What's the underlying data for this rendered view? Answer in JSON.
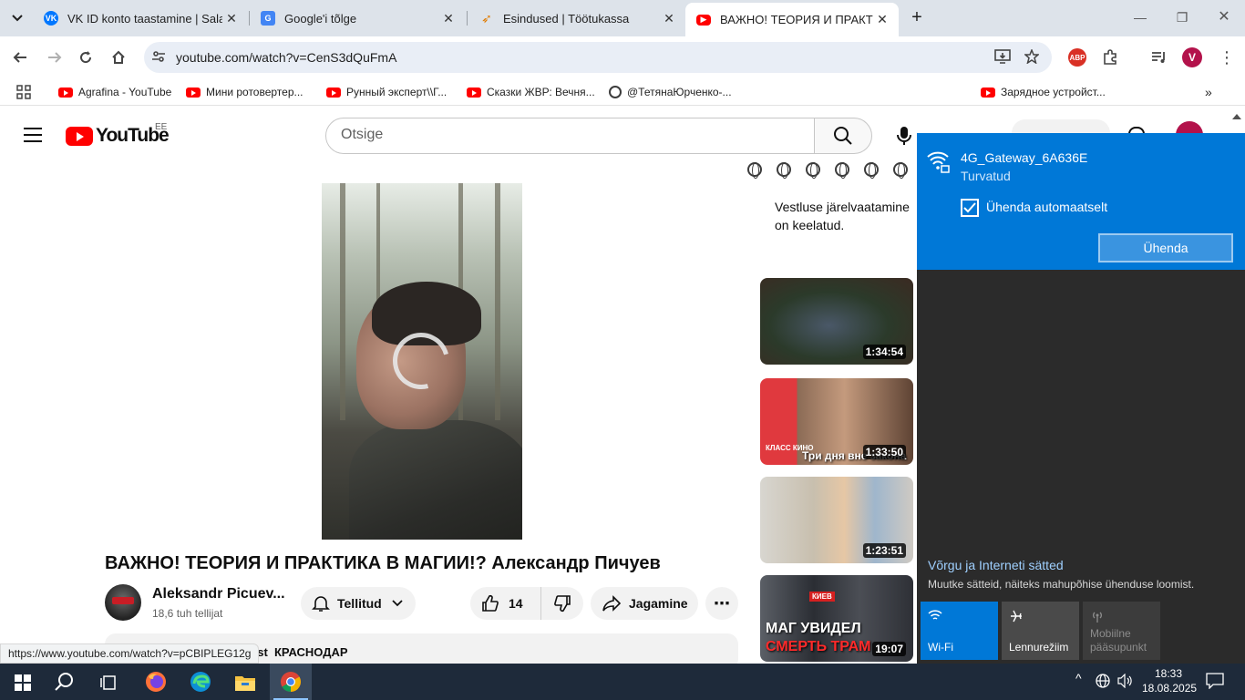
{
  "browser": {
    "tabs": [
      {
        "title": "VK ID konto taastamine | Salasõ",
        "active": false
      },
      {
        "title": "Google'i tõlge",
        "active": false
      },
      {
        "title": "Esindused | Töötukassa",
        "active": false
      },
      {
        "title": "ВАЖНО! ТЕОРИЯ И ПРАКТИКА В МАГИИ!?",
        "active": true
      }
    ],
    "url": "youtube.com/watch?v=CenS3dQuFmA",
    "profile_initial": "V",
    "abp_label": "ABP",
    "bookmarks": [
      "Agrafina - YouTube",
      "Мини ротовертер...",
      "Рунный эксперт\\\\Г...",
      "Сказки ЖВР: Вечня...",
      "@ТетянаЮрченко-...",
      "Зарядное устройст..."
    ]
  },
  "youtube": {
    "logo_text": "YouTube",
    "country_code": "EE",
    "search_placeholder": "Otsige",
    "video_title": "ВАЖНО! ТЕОРИЯ И ПРАКТИКА В МАГИИ!? Александр Пичуев",
    "channel_name": "Aleksandr Picuev...",
    "subscribers": "18,6 tuh tellijat",
    "subscribe_label": "Tellitud",
    "like_count": "14",
    "share_label": "Jagamine",
    "description_preview": "КРАСНОДАР",
    "description_prefix": "est",
    "chat_disabled": "Vestluse järelvaatamine on keelatud.",
    "recommendations": [
      {
        "duration": "1:34:54"
      },
      {
        "duration": "1:33:50",
        "caption": "Три дня вне закона",
        "logo": "КЛАСС КИНО"
      },
      {
        "duration": "1:23:51"
      },
      {
        "duration": "19:07",
        "caption": "МАГ УВИДЕЛ",
        "caption2": "СМЕРТЬ ТРАМ",
        "tag": "КИЕВ"
      }
    ]
  },
  "status_bar_url": "https://www.youtube.com/watch?v=pCBIPLEG12g",
  "network_flyout": {
    "ssid": "4G_Gateway_6A636E",
    "status": "Turvatud",
    "auto_connect_label": "Ühenda automaatselt",
    "auto_connect_checked": true,
    "connect_button": "Ühenda",
    "settings_link": "Võrgu ja Interneti sätted",
    "settings_sub": "Muutke sätteid, näiteks mahupõhise ühenduse loomist.",
    "quick_actions": [
      "Wi-Fi",
      "Lennurežiim",
      "Mobiilne pääsupunkt"
    ]
  },
  "taskbar": {
    "time": "18:33",
    "date": "18.08.2025"
  },
  "colors": {
    "youtube_red": "#ff0000",
    "windows_accent": "#0078d7",
    "taskbar": "#1e2a3a"
  }
}
